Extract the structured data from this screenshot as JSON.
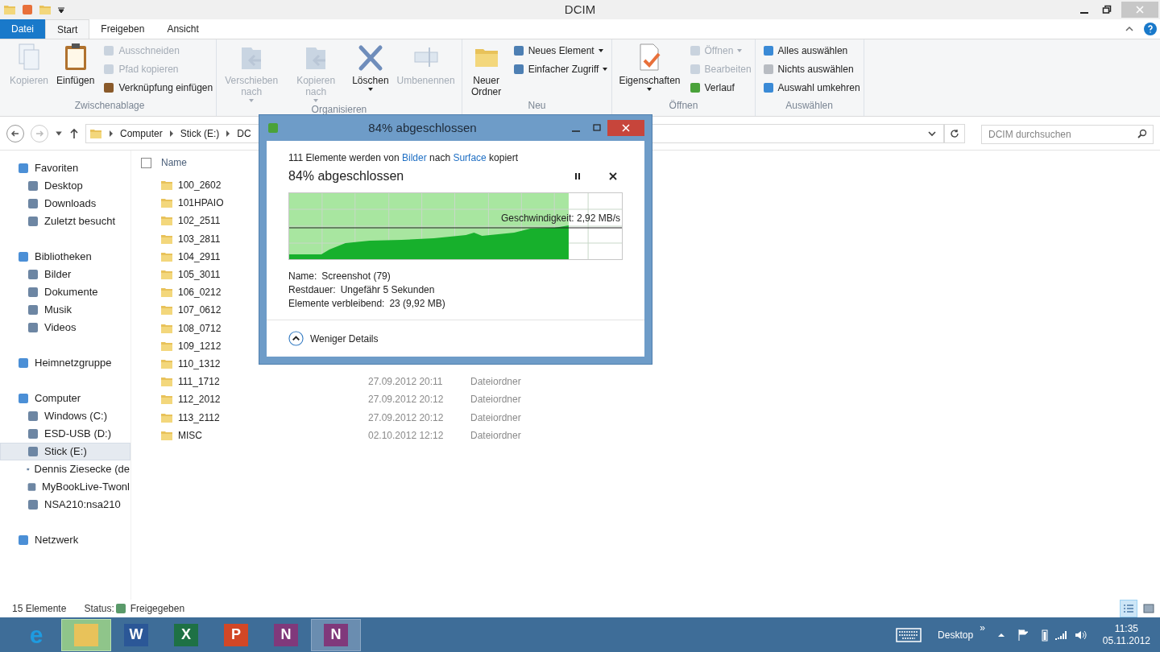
{
  "window": {
    "title": "DCIM"
  },
  "ribbon_tabs": [
    {
      "label": "Datei",
      "kind": "file",
      "selected": false
    },
    {
      "label": "Start",
      "kind": "tab",
      "selected": true
    },
    {
      "label": "Freigeben",
      "kind": "tab",
      "selected": false
    },
    {
      "label": "Ansicht",
      "kind": "tab",
      "selected": false
    }
  ],
  "ribbon_groups": [
    {
      "label": "Zwischenablage",
      "items": [
        {
          "label": "Kopieren",
          "kind": "large",
          "disabled": true,
          "caret": false
        },
        {
          "label": "Einfügen",
          "kind": "large",
          "disabled": false,
          "caret": false
        },
        {
          "label": "Ausschneiden",
          "kind": "small",
          "disabled": true,
          "caret": false
        },
        {
          "label": "Pfad kopieren",
          "kind": "small",
          "disabled": true,
          "caret": false
        },
        {
          "label": "Verknüpfung einfügen",
          "kind": "small",
          "disabled": false,
          "caret": false
        }
      ]
    },
    {
      "label": "Organisieren",
      "items": [
        {
          "label": "Verschieben nach",
          "kind": "large",
          "disabled": true,
          "caret": true
        },
        {
          "label": "Kopieren nach",
          "kind": "large",
          "disabled": true,
          "caret": true
        },
        {
          "label": "Löschen",
          "kind": "large",
          "disabled": false,
          "caret": true
        },
        {
          "label": "Umbenennen",
          "kind": "large",
          "disabled": true,
          "caret": false
        }
      ]
    },
    {
      "label": "Neu",
      "items": [
        {
          "label": "Neuer Ordner",
          "kind": "large",
          "disabled": false,
          "caret": false
        },
        {
          "label": "Neues Element",
          "kind": "small",
          "disabled": false,
          "caret": true
        },
        {
          "label": "Einfacher Zugriff",
          "kind": "small",
          "disabled": false,
          "caret": true
        }
      ]
    },
    {
      "label": "Öffnen",
      "items": [
        {
          "label": "Eigenschaften",
          "kind": "large",
          "disabled": false,
          "caret": true
        },
        {
          "label": "Öffnen",
          "kind": "small",
          "disabled": true,
          "caret": true
        },
        {
          "label": "Bearbeiten",
          "kind": "small",
          "disabled": true,
          "caret": false
        },
        {
          "label": "Verlauf",
          "kind": "small",
          "disabled": false,
          "caret": false
        }
      ]
    },
    {
      "label": "Auswählen",
      "items": [
        {
          "label": "Alles auswählen",
          "kind": "small",
          "disabled": false,
          "caret": false
        },
        {
          "label": "Nichts auswählen",
          "kind": "small",
          "disabled": false,
          "caret": false
        },
        {
          "label": "Auswahl umkehren",
          "kind": "small",
          "disabled": false,
          "caret": false
        }
      ]
    }
  ],
  "address": {
    "breadcrumbs": [
      "Computer",
      "Stick (E:)",
      "DC"
    ],
    "search_placeholder": "DCIM durchsuchen"
  },
  "nav": [
    {
      "label": "Favoriten",
      "selected": false,
      "children": [
        {
          "label": "Desktop",
          "selected": false
        },
        {
          "label": "Downloads",
          "selected": false
        },
        {
          "label": "Zuletzt besucht",
          "selected": false
        }
      ]
    },
    {
      "label": "Bibliotheken",
      "selected": false,
      "children": [
        {
          "label": "Bilder",
          "selected": false
        },
        {
          "label": "Dokumente",
          "selected": false
        },
        {
          "label": "Musik",
          "selected": false
        },
        {
          "label": "Videos",
          "selected": false
        }
      ]
    },
    {
      "label": "Heimnetzgruppe",
      "selected": false
    },
    {
      "label": "Computer",
      "selected": false,
      "children": [
        {
          "label": "Windows (C:)",
          "selected": false
        },
        {
          "label": "ESD-USB (D:)",
          "selected": false
        },
        {
          "label": "Stick (E:)",
          "selected": true
        },
        {
          "label": "Dennis Ziesecke (de",
          "selected": false
        },
        {
          "label": "MyBookLive-Twonl",
          "selected": false
        },
        {
          "label": "NSA210:nsa210",
          "selected": false
        }
      ]
    },
    {
      "label": "Netzwerk",
      "selected": false
    }
  ],
  "file_list": {
    "columns": [
      "Name"
    ],
    "select_all_checked": false,
    "rows": [
      {
        "name": "100_2602"
      },
      {
        "name": "101HPAIO"
      },
      {
        "name": "102_2511"
      },
      {
        "name": "103_2811"
      },
      {
        "name": "104_2911"
      },
      {
        "name": "105_3011"
      },
      {
        "name": "106_0212"
      },
      {
        "name": "107_0612"
      },
      {
        "name": "108_0712"
      },
      {
        "name": "109_1212"
      },
      {
        "name": "110_1312"
      },
      {
        "name": "111_1712",
        "date": "27.09.2012 20:11",
        "type": "Dateiordner"
      },
      {
        "name": "112_2012",
        "date": "27.09.2012 20:12",
        "type": "Dateiordner"
      },
      {
        "name": "113_2112",
        "date": "27.09.2012 20:12",
        "type": "Dateiordner"
      },
      {
        "name": "MISC",
        "date": "02.10.2012 12:12",
        "type": "Dateiordner"
      }
    ]
  },
  "status_bar": {
    "count": "15 Elemente",
    "status_label": "Status:",
    "status": "Freigegeben"
  },
  "view_buttons": [
    {
      "kind": "details",
      "selected": true
    },
    {
      "kind": "tiles",
      "selected": false
    }
  ],
  "copy_dialog": {
    "title": "84% abgeschlossen",
    "summary": {
      "prefix": "111 Elemente werden von",
      "source": "Bilder",
      "middle": "nach",
      "target": "Surface",
      "suffix": "kopiert"
    },
    "heading": "84% abgeschlossen",
    "level": 0.84,
    "speed": "Geschwindigkeit: 2,92 MB/s",
    "details": [
      {
        "label": "Name:",
        "value": "Screenshot (79)"
      },
      {
        "label": "Restdauer:",
        "value": "Ungefähr 5 Sekunden"
      },
      {
        "label": "Elemente verbleibend:",
        "value": "23 (9,92 MB)"
      }
    ],
    "toggle": "Weniger Details",
    "expanded": true
  },
  "taskbar": {
    "apps": [
      {
        "kind": "ie",
        "glyph": "e",
        "active": false
      },
      {
        "kind": "explorer",
        "active": true
      },
      {
        "kind": "word",
        "glyph": "W",
        "active": false
      },
      {
        "kind": "excel",
        "glyph": "X",
        "active": false
      },
      {
        "kind": "powerpoint",
        "glyph": "P",
        "active": false
      },
      {
        "kind": "onenote",
        "glyph": "N",
        "active": false
      },
      {
        "kind": "clip",
        "glyph": "N",
        "active": true
      }
    ],
    "toolbar": "Desktop",
    "chevron": "»",
    "time": "11:35",
    "date": "05.11.2012"
  }
}
